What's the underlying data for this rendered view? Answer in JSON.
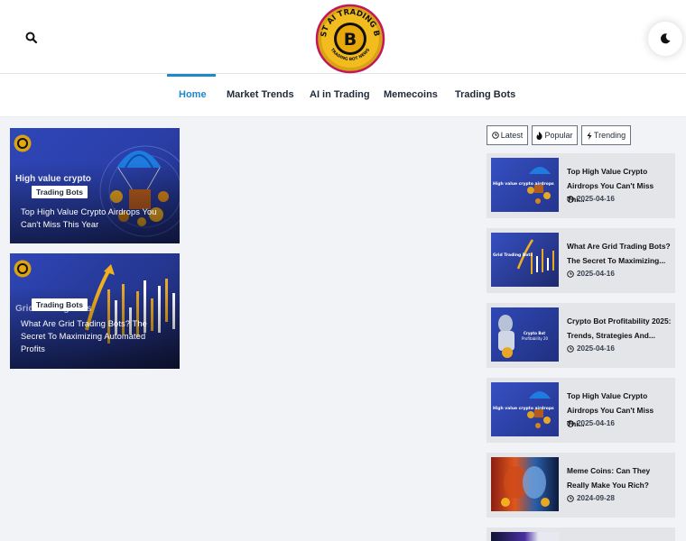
{
  "header": {
    "logo_text_top": "BEST AI TRADING BOT",
    "logo_text_bottom": "TRADING BOT NEWS"
  },
  "nav": {
    "items": [
      {
        "label": "Home",
        "active": true
      },
      {
        "label": "Market Trends"
      },
      {
        "label": "AI in Trading"
      },
      {
        "label": "Memecoins"
      },
      {
        "label": "Trading Bots"
      }
    ]
  },
  "cards": [
    {
      "tag": "Trading Bots",
      "title": "Top High Value Crypto Airdrops You Can't Miss This Year",
      "watermark": "High value crypto"
    },
    {
      "tag": "Trading Bots",
      "title": "What Are Grid Trading Bots? The Secret To Maximizing Automated Profits",
      "watermark": "Grid Trading Bots"
    }
  ],
  "sidebar": {
    "tabs": [
      {
        "label": "Latest",
        "icon": "clock-icon"
      },
      {
        "label": "Popular",
        "icon": "fire-icon"
      },
      {
        "label": "Trending",
        "icon": "bolt-icon"
      }
    ],
    "posts": [
      {
        "title": "Top High Value Crypto Airdrops You Can't Miss Thi...",
        "date": "2025-04-16",
        "thumb_text": "High value crypto airdrops"
      },
      {
        "title": "What Are Grid Trading Bots? The Secret To Maximizing...",
        "date": "2025-04-16",
        "thumb_text": "Grid Trading Bots"
      },
      {
        "title": "Crypto Bot Profitability 2025: Trends, Strategies And...",
        "date": "2025-04-16",
        "thumb_text": "Crypto Bot Profitability 2025"
      },
      {
        "title": "Top High Value Crypto Airdrops You Can't Miss Thi...",
        "date": "2025-04-16",
        "thumb_text": "High value crypto airdrops"
      },
      {
        "title": "Meme Coins: Can They Really Make You Rich?",
        "date": "2024-09-28"
      }
    ]
  },
  "colors": {
    "accent": "#1e88c9",
    "card_blue": "#2f46b8"
  }
}
